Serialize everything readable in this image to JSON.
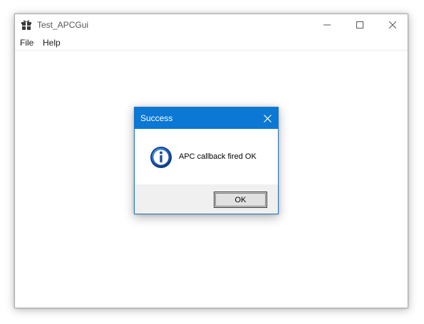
{
  "window": {
    "title": "Test_APCGui",
    "app_icon": "gift-box-icon",
    "controls": [
      "minimize-icon",
      "maximize-icon",
      "close-icon"
    ]
  },
  "menubar": {
    "items": [
      {
        "label": "File"
      },
      {
        "label": "Help"
      }
    ]
  },
  "dialog": {
    "title": "Success",
    "icon": "information-icon",
    "message": "APC callback fired OK",
    "ok_label": "OK",
    "accent_color": "#0a78d4"
  }
}
